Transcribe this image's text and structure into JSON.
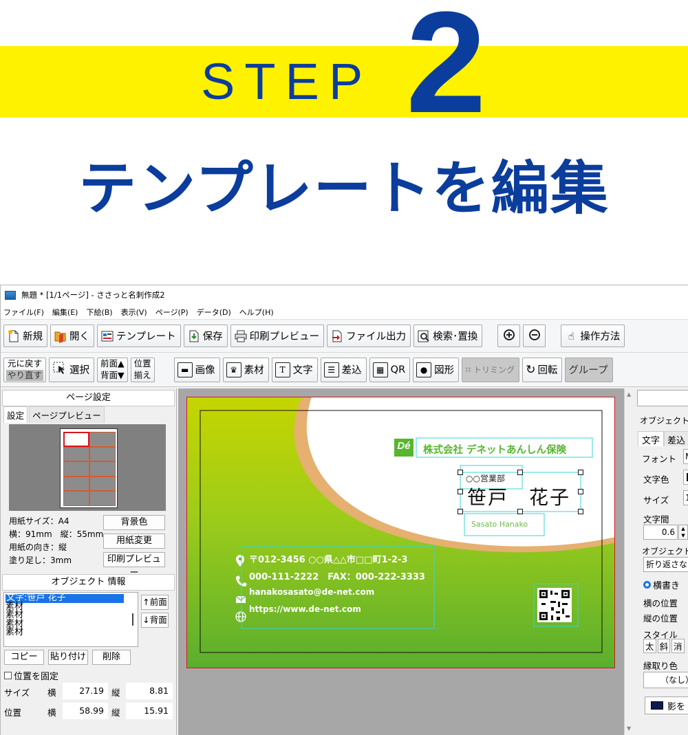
{
  "banner": {
    "step_word": "STEP",
    "step_number": "2",
    "headline": "テンプレートを編集",
    "accent_color": "#fff200",
    "text_color": "#0b3d9c"
  },
  "window": {
    "title": "無題 * [1/1ページ] - ささっと名刺作成2",
    "menu": [
      "ファイル(F)",
      "編集(E)",
      "下絵(B)",
      "表示(V)",
      "ページ(P)",
      "データ(D)",
      "ヘルプ(H)"
    ]
  },
  "toolbar1": {
    "new": "新規",
    "open": "開く",
    "template": "テンプレート",
    "save": "保存",
    "print_preview": "印刷プレビュー",
    "file_output": "ファイル出力",
    "search_replace": "検索･置換",
    "how_to": "操作方法"
  },
  "toolbar2": {
    "undo": "元に戻す",
    "redo": "やり直す",
    "select": "選択",
    "bring_front": "前面▲",
    "send_back": "背面▼",
    "position": "位置",
    "align": "揃え",
    "image": "画像",
    "material": "素材",
    "text": "文字",
    "insert": "差込",
    "qr": "QR",
    "shape": "図形",
    "trimming": "トリミング",
    "rotate": "回転",
    "group": "グループ"
  },
  "page_settings": {
    "header": "ページ設定",
    "tab_settings": "設定",
    "tab_preview": "ページプレビュー",
    "paper_size": "用紙サイズ：A4",
    "dimensions": "横：91mm　縦：55mm",
    "orientation": "用紙の向き：縦",
    "bleed": "塗り足し：3mm",
    "bg_color_btn": "背景色",
    "change_paper_btn": "用紙変更",
    "print_preview_btn": "印刷プレビュー"
  },
  "object_info": {
    "header": "オブジェクト 情報",
    "items": [
      "文字:笹戸 花子",
      "素材",
      "素材",
      "素材",
      "素材"
    ],
    "front_btn": "↑前面",
    "back_btn": "↓背面",
    "copy_btn": "コピー",
    "paste_btn": "貼り付け",
    "delete_btn": "削除",
    "fix_position": "位置を固定",
    "size_label": "サイズ",
    "position_label": "位置",
    "horizontal": "横",
    "vertical": "縦",
    "size_w": "27.19",
    "size_h": "8.81",
    "pos_x": "58.99",
    "pos_y": "15.91"
  },
  "card": {
    "company": "株式会社 デネットあんしん保険",
    "logo": "Dé",
    "department": "○○営業部",
    "name": "笹戸　花子",
    "name_romaji": "Sasato Hanako",
    "address": "〒012-3456 ○○県△△市□□町1-2-3",
    "phone": "000-111-2222　FAX：000-222-3333",
    "email": "hanakosasato@de-net.com",
    "url": "https://www.de-net.com",
    "green_color": "#7cbf2a",
    "company_color": "#58b52e"
  },
  "right_panel": {
    "object_label": "オブジェクト名",
    "tab_text": "文字",
    "tab_insert": "差込",
    "font": "フォント",
    "font_value": "M",
    "text_color": "文字色",
    "size": "サイズ",
    "size_value": "1",
    "spacing": "文字間",
    "spacing_value": "0.6",
    "object_size": "オブジェクトサイズ",
    "wrap": "折り返さない",
    "horizontal_writing": "横書き",
    "h_position": "横の位置",
    "v_position": "縦の位置",
    "style": "スタイル",
    "bold": "太",
    "italic": "斜",
    "strike": "消",
    "outline_color": "縁取り色",
    "none": "（なし）",
    "shadow": "影を"
  }
}
